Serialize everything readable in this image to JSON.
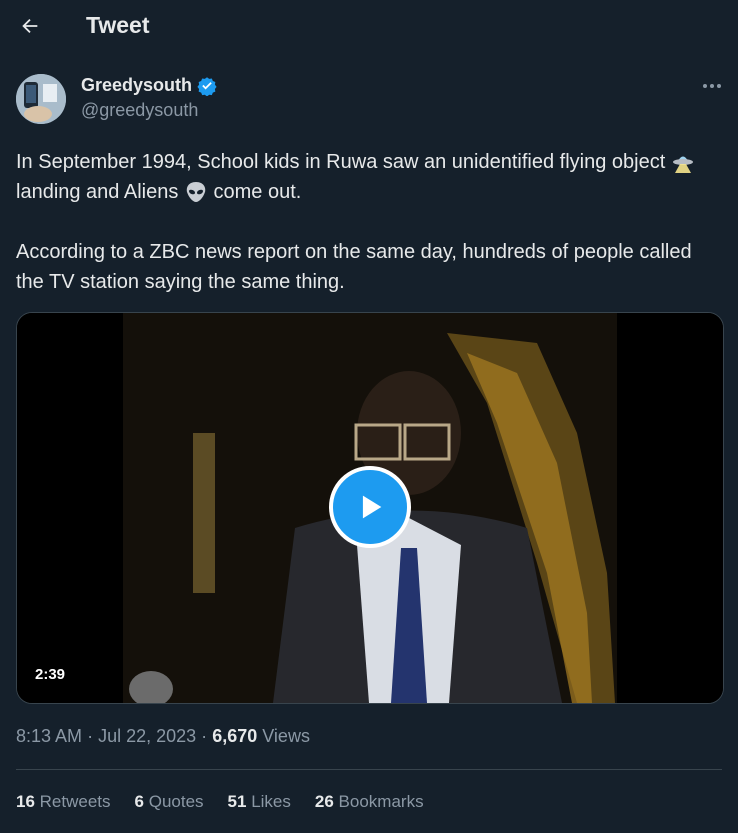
{
  "header": {
    "title": "Tweet",
    "back_icon": "arrow-left-icon"
  },
  "author": {
    "name": "Greedysouth",
    "handle": "@greedysouth",
    "verified": true,
    "verified_color": "#1d9bf0"
  },
  "tweet": {
    "paragraph1_part1": "In September 1994, School kids in Ruwa saw an unidentified flying object",
    "paragraph1_part2": "landing and Aliens",
    "paragraph1_part3": "come out.",
    "emoji1": "ufo-emoji",
    "emoji2": "alien-emoji",
    "paragraph2": "According to a ZBC news report on the same day, hundreds of people called the TV station saying the same thing."
  },
  "video": {
    "duration": "2:39",
    "play_icon": "play-icon"
  },
  "meta": {
    "time": "8:13 AM",
    "sep1": "·",
    "date": "Jul 22, 2023",
    "sep2": "·",
    "views_count": "6,670",
    "views_label": "Views"
  },
  "stats": {
    "retweets_count": "16",
    "retweets_label": "Retweets",
    "quotes_count": "6",
    "quotes_label": "Quotes",
    "likes_count": "51",
    "likes_label": "Likes",
    "bookmarks_count": "26",
    "bookmarks_label": "Bookmarks"
  },
  "colors": {
    "background": "#15202b",
    "text": "#e7e9ea",
    "muted": "#8b98a5",
    "accent": "#1d9bf0",
    "border": "#38444d"
  }
}
